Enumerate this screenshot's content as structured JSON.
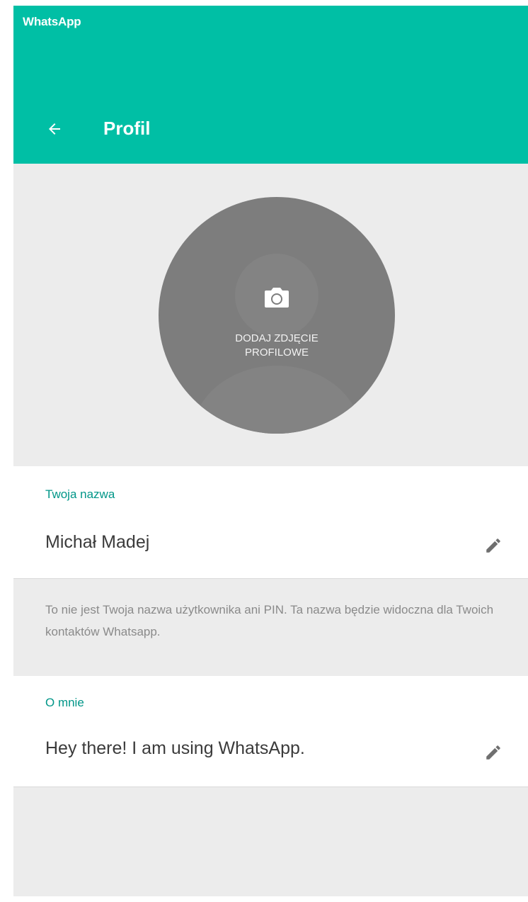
{
  "window": {
    "title": "WhatsApp"
  },
  "header": {
    "title": "Profil",
    "back_icon": "arrow-left-icon",
    "background_color": "#00bfa5"
  },
  "profile_photo": {
    "label": "DODAJ ZDJĘCIE\nPROFILOWE",
    "icon": "camera-icon"
  },
  "name_field": {
    "label": "Twoja nazwa",
    "value": "Michał Madej",
    "edit_icon": "pencil-icon"
  },
  "name_hint": "To nie jest Twoja nazwa użytkownika ani PIN. Ta nazwa będzie widoczna dla Twoich kontaktów Whatsapp.",
  "about_field": {
    "label": "O mnie",
    "value": "Hey there! I am using WhatsApp.",
    "edit_icon": "pencil-icon"
  },
  "colors": {
    "accent": "#00bfa5",
    "label_color": "#009688",
    "background": "#ececec"
  }
}
